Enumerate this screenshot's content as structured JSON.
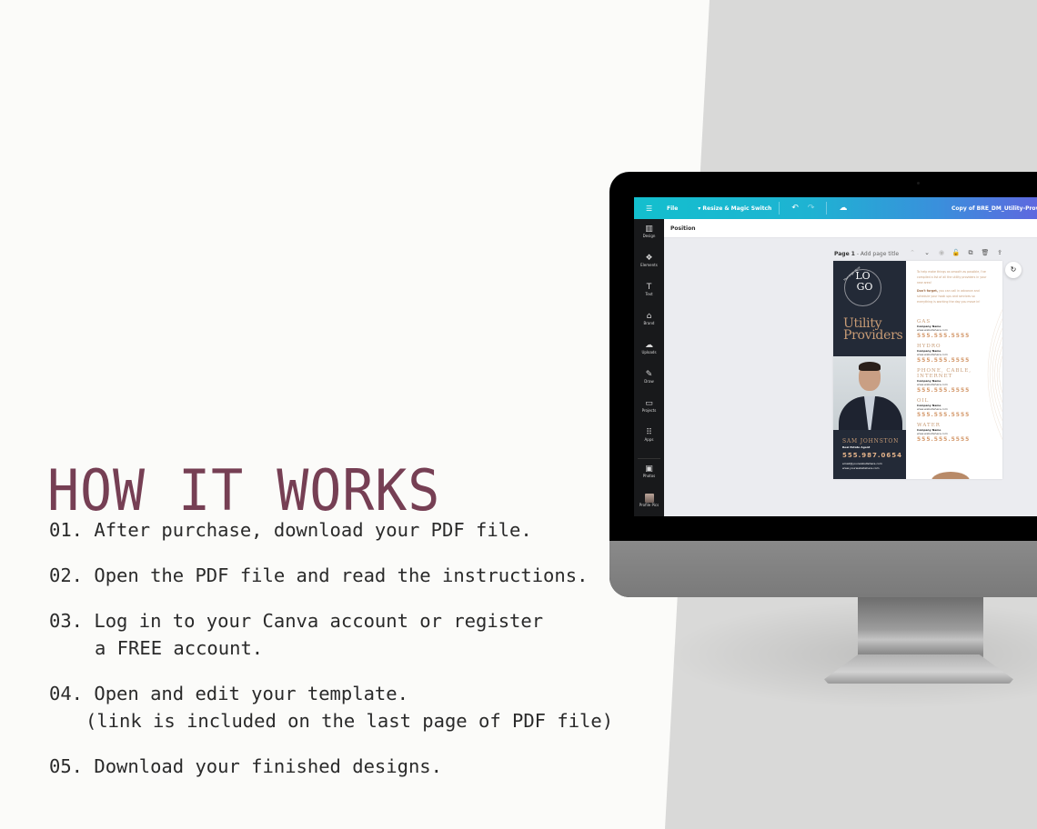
{
  "heading": "HOW IT WORKS",
  "steps": [
    {
      "number": "01.",
      "text": "After purchase, download your PDF file.",
      "continuation": ""
    },
    {
      "number": "02.",
      "text": "Open the PDF file and read the instructions.",
      "continuation": ""
    },
    {
      "number": "03.",
      "text": "Log in to your Canva account or register",
      "continuation": "a FREE account."
    },
    {
      "number": "04.",
      "text": "Open and edit your template.",
      "continuation": "(link is included on the last page of PDF file)"
    },
    {
      "number": "05.",
      "text": "Download your finished designs.",
      "continuation": ""
    }
  ],
  "colors": {
    "heading": "#763f54",
    "canva_gradient_start": "#13bfce",
    "canva_gradient_end": "#6a5ae0",
    "accent_gold": "#c79b75",
    "navy": "#232a37"
  },
  "canva": {
    "topbar": {
      "menu_icon": "hamburger-icon",
      "file_label": "File",
      "resize_label": "▾ Resize & Magic Switch",
      "undo_icon": "↶",
      "redo_icon": "↷",
      "cloud_icon": "☁",
      "document_title": "Copy of BRE_DM_Utility-Provid"
    },
    "sidebar": [
      {
        "icon": "▥",
        "label": "Design"
      },
      {
        "icon": "❖",
        "label": "Elements"
      },
      {
        "icon": "T",
        "label": "Text"
      },
      {
        "icon": "⌂",
        "label": "Brand"
      },
      {
        "icon": "☁",
        "label": "Uploads"
      },
      {
        "icon": "✎",
        "label": "Draw"
      },
      {
        "icon": "▭",
        "label": "Projects"
      },
      {
        "icon": "⠿",
        "label": "Apps"
      },
      {
        "icon": "▣",
        "label": "Photos"
      },
      {
        "icon": "",
        "label": "Profile Pics"
      }
    ],
    "position_label": "Position",
    "page_header": {
      "page": "Page 1",
      "separator": " - ",
      "title_placeholder": "Add page title"
    },
    "page_tools": [
      "⌃",
      "⌄",
      "◉",
      "🔓",
      "⧉",
      "🗑",
      "⇪"
    ],
    "refresh_icon": "↻"
  },
  "design": {
    "logo_top": "LO",
    "logo_bottom": "GO",
    "logo_arc_text": "Your Logo Here",
    "title_line1": "Utility",
    "title_line2": "Providers",
    "agent_name": "SAM JOHNSTON",
    "agent_role": "Real Estate Agent",
    "agent_phone": "555.987.0654",
    "agent_email": "email@yourwebsitehere.com",
    "agent_website": "www.yourwebsitehere.com",
    "intro_1": "To help make things as smooth as possible, I've compiled a list of all the utility providers in your new area!",
    "intro_2_bold": "Don't forget,",
    "intro_2": " you can call in advance and schedule your hook ups and services so everything is working the day you move in!",
    "utilities": [
      {
        "category": "GAS",
        "company": "Company Name",
        "website": "www.websitehere.com",
        "phone": "555.555.5555"
      },
      {
        "category": "HYDRO",
        "company": "Company Name",
        "website": "www.websitehere.com",
        "phone": "555.555.5555"
      },
      {
        "category": "PHONE, CABLE, INTERNET",
        "company": "Company Name",
        "website": "www.websitehere.com",
        "phone": "555.555.5555"
      },
      {
        "category": "OIL",
        "company": "Company Name",
        "website": "www.websitehere.com",
        "phone": "555.555.5555"
      },
      {
        "category": "WATER",
        "company": "Company Name",
        "website": "www.websitehere.com",
        "phone": "555.555.5555"
      }
    ]
  }
}
